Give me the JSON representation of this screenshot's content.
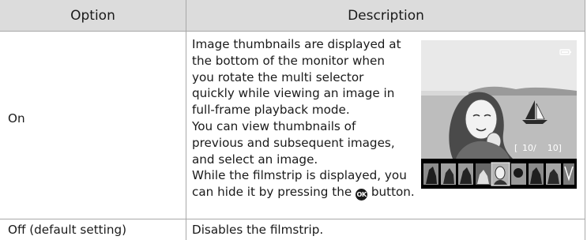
{
  "table": {
    "header": {
      "option": "Option",
      "description": "Description"
    },
    "rows": [
      {
        "option": "On",
        "description_lines": [
          "Image thumbnails are displayed at",
          "the bottom of the monitor when",
          "you rotate the multi selector",
          "quickly while viewing an image in",
          "full-frame playback mode.",
          "You can view thumbnails of",
          "previous and subsequent images,",
          "and select an image.",
          "While the filmstrip is displayed, you"
        ],
        "description_last_prefix": "can hide it by pressing the",
        "description_last_suffix": "button.",
        "ok_button_label": "OK",
        "monitor": {
          "frame_counter": "10/    10]",
          "frame_counter_bracket": "[",
          "icons": [
            "battery-icon"
          ]
        }
      },
      {
        "option": "Off (default setting)",
        "description": "Disables the filmstrip."
      }
    ]
  },
  "colors": {
    "header_background": "#dcdcdc",
    "border": "#a8a8a8",
    "text": "#1a1a1a"
  }
}
